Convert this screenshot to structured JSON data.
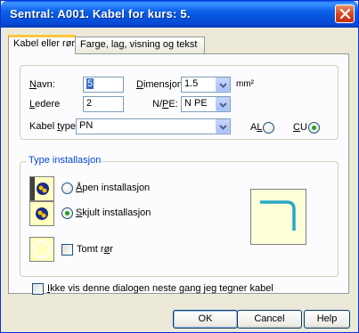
{
  "window": {
    "title": "Sentral: A001. Kabel for kurs: 5."
  },
  "tabs": [
    {
      "label": "Kabel eller rør"
    },
    {
      "label": "Farge, lag, visning og tekst"
    }
  ],
  "cable": {
    "navn": {
      "label_u": "N",
      "label_rest": "avn:",
      "value": "5"
    },
    "ledere": {
      "label_u": "L",
      "label_rest": "edere",
      "value": "2"
    },
    "dimensjon": {
      "label_u": "D",
      "label_rest": "imensjon:",
      "value": "1.5",
      "unit": "mm²"
    },
    "npe": {
      "label_pre": "N/",
      "label_u": "P",
      "label_rest": "E:",
      "value": "N PE"
    },
    "kabeltype": {
      "label_pre": "Kabel ",
      "label_u": "t",
      "label_rest": "ype",
      "value": "PN"
    },
    "al": {
      "label_pre": "A",
      "label_u": "L",
      "checked": false
    },
    "cu": {
      "label_u": "C",
      "label_rest": "U",
      "checked": true
    }
  },
  "installation": {
    "caption": "Type installasjon",
    "options": [
      {
        "label_u": "Å",
        "label_rest": "pen installasjon",
        "checked": false
      },
      {
        "label_u": "S",
        "label_rest": "kjult installasjon",
        "checked": true
      }
    ],
    "empty_pipe": {
      "label_pre": "Tomt r",
      "label_u": "ø",
      "label_rest": "r",
      "checked": false
    }
  },
  "dont_show": {
    "label_u": "I",
    "label_rest": "kke vis denne dialogen neste gang jeg tegner kabel",
    "checked": false
  },
  "buttons": {
    "ok": "OK",
    "cancel": "Cancel",
    "help": "Help"
  },
  "colors": {
    "title_bar": "#0a5fe8",
    "accent_radio": "#21a121",
    "group_caption": "#0046d5",
    "tab_highlight": "#ffc83c"
  }
}
